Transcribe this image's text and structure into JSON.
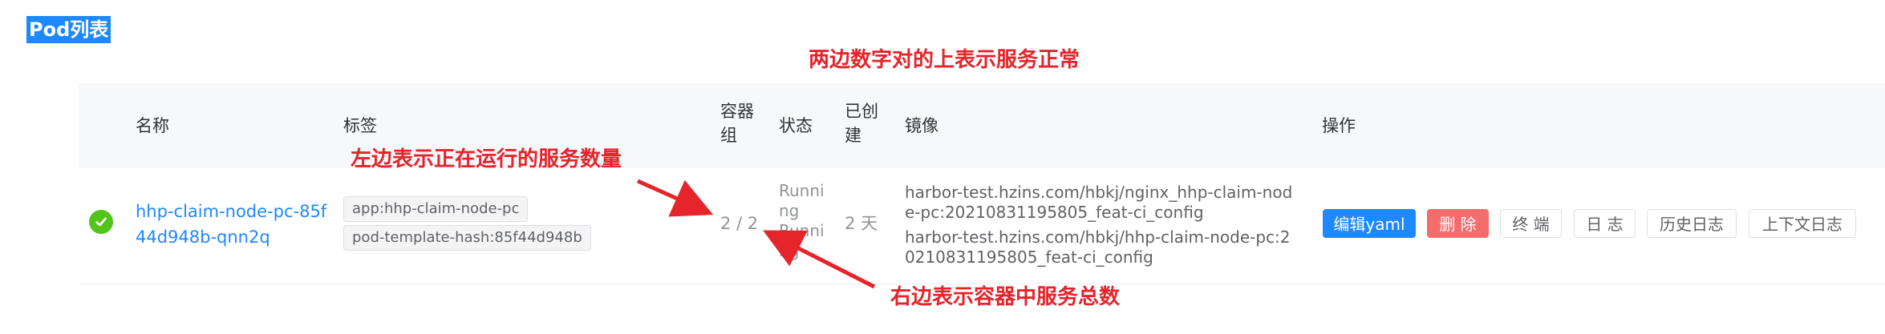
{
  "section": {
    "title": "Pod列表"
  },
  "annotations": {
    "top": "两边数字对的上表示服务正常",
    "left": "左边表示正在运行的服务数量",
    "right": "右边表示容器中服务总数",
    "color": "#e5242b"
  },
  "table": {
    "headers": {
      "name": "名称",
      "labels": "标签",
      "containers_line1": "容器",
      "containers_line2": "组",
      "status": "状态",
      "created_line1": "已创",
      "created_line2": "建",
      "image": "镜像",
      "actions": "操作"
    },
    "row": {
      "status_icon": "check-circle-icon",
      "name_line1": "hhp-claim-node-pc-85f",
      "name_line2": "44d948b-qnn2q",
      "labels": [
        "app:hhp-claim-node-pc",
        "pod-template-hash:85f44d948b"
      ],
      "containers": "2 / 2",
      "status_lines": [
        "Runni",
        "ng",
        "Runni",
        "ng"
      ],
      "created": "2 天",
      "images": [
        "harbor-test.hzins.com/hbkj/nginx_hhp-claim-node-pc:20210831195805_feat-ci_config",
        "harbor-test.hzins.com/hbkj/hhp-claim-node-pc:20210831195805_feat-ci_config"
      ]
    },
    "actions": {
      "edit": "编辑yaml",
      "delete": "删 除",
      "terminal": "终 端",
      "log": "日 志",
      "history_log": "历史日志",
      "context_log": "上下文日志"
    }
  },
  "colors": {
    "accent": "#1e88ff",
    "success": "#52c41a",
    "danger": "#f56c6c"
  }
}
